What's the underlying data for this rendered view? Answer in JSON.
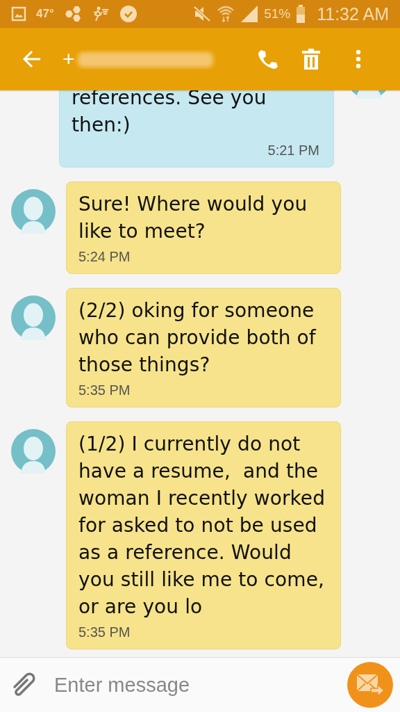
{
  "status_bar": {
    "temperature": "47°",
    "battery": "51%",
    "time": "11:32 AM"
  },
  "app_bar": {
    "title": "+"
  },
  "messages": [
    {
      "kind": "sent",
      "text": "references. See you then:)",
      "time": "5:21 PM"
    },
    {
      "kind": "received",
      "text": "Sure! Where would you like to meet?",
      "time": "5:24 PM"
    },
    {
      "kind": "received",
      "text": "(2/2) oking for someone who can provide both of those things?",
      "time": "5:35 PM"
    },
    {
      "kind": "received",
      "text": "(1/2) I currently do not have a resume,  and the woman I recently worked for asked to not be used as a reference. Would you still like me to come, or are you lo",
      "time": "5:35 PM"
    }
  ],
  "composer": {
    "placeholder": "Enter message"
  }
}
